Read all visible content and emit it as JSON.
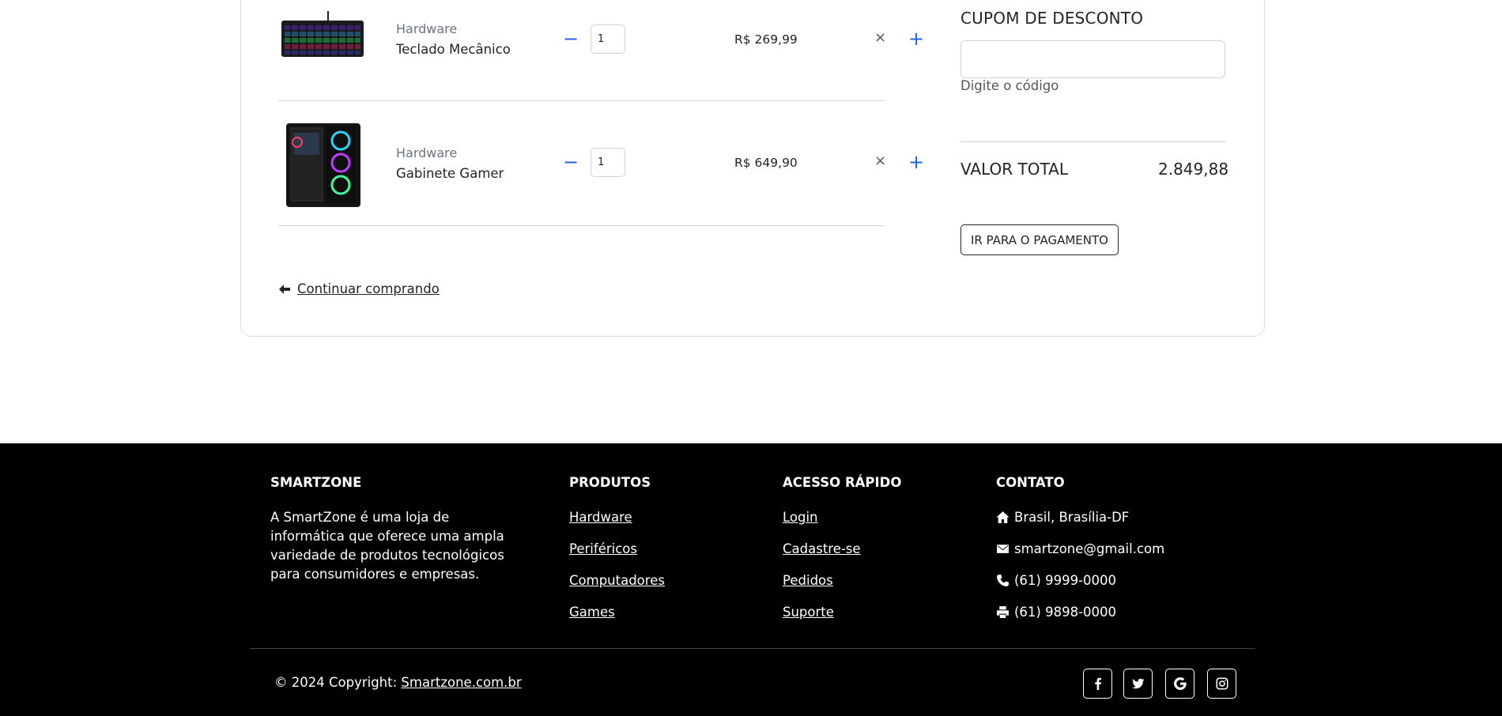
{
  "cart": {
    "items": [
      {
        "category": "Hardware",
        "name": "Teclado Mecânico",
        "quantity": "1",
        "price": "R$ 269,99",
        "image": "keyboard-image"
      },
      {
        "category": "Hardware",
        "name": "Gabinete Gamer",
        "quantity": "1",
        "price": "R$ 649,90",
        "image": "pc-case-image"
      }
    ],
    "qty_minus": "−",
    "qty_plus": "+",
    "remove": "×",
    "continue_label": "Continuar comprando"
  },
  "summary": {
    "coupon_title": "CUPOM DE DESCONTO",
    "coupon_value": "",
    "coupon_hint": "Digite o código",
    "total_label": "VALOR TOTAL",
    "total_value": "2.849,88",
    "pay_button": "IR PARA O PAGAMENTO"
  },
  "footer": {
    "about": {
      "heading": "SMARTZONE",
      "text": "A SmartZone é uma loja de informática que oferece uma ampla variedade de produtos tecnológicos para consumidores e empresas."
    },
    "products": {
      "heading": "PRODUTOS",
      "links": [
        "Hardware",
        "Periféricos",
        "Computadores",
        "Games"
      ]
    },
    "quick_access": {
      "heading": "ACESSO RÁPIDO",
      "links": [
        "Login",
        "Cadastre-se",
        "Pedidos",
        "Suporte"
      ]
    },
    "contact": {
      "heading": "CONTATO",
      "address": "Brasil, Brasília-DF",
      "email": "smartzone@gmail.com",
      "phone": "(61) 9999-0000",
      "fax": "(61) 9898-0000"
    },
    "copyright_prefix": "© 2024 Copyright: ",
    "copyright_link": "Smartzone.com.br",
    "social_icons": [
      "facebook-icon",
      "twitter-icon",
      "google-icon",
      "instagram-icon"
    ]
  },
  "colors": {
    "accent": "#2563eb",
    "footer_bg": "#000000"
  }
}
